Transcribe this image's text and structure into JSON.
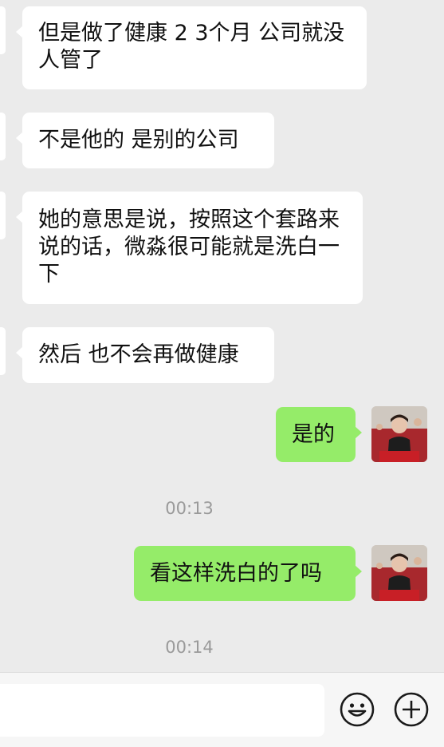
{
  "messages": [
    {
      "side": "in",
      "text": "但是做了健康 2 3个月 公司就没人管了"
    },
    {
      "side": "in",
      "text": "不是他的 是别的公司"
    },
    {
      "side": "in",
      "text": "她的意思是说，按照这个套路来说的话，微淼很可能就是洗白一下"
    },
    {
      "side": "in",
      "text": "然后 也不会再做健康"
    },
    {
      "side": "out",
      "text": "是的"
    },
    {
      "side": "out",
      "text": "看这样洗白的了吗"
    }
  ],
  "timestamps": [
    "00:13",
    "00:14"
  ],
  "input_bar": {
    "emoji_icon": "smiley-face-icon",
    "more_icon": "plus-circle-icon"
  },
  "colors": {
    "background": "#ebebeb",
    "incoming_bubble": "#ffffff",
    "outgoing_bubble": "#95ec69",
    "timestamp_text": "#9a9a9a"
  }
}
